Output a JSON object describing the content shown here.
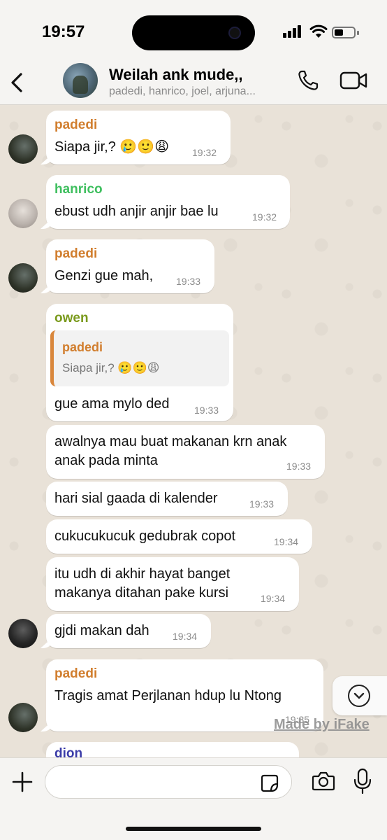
{
  "status_bar": {
    "time": "19:57",
    "battery_level": 0.45
  },
  "header": {
    "title": "Weilah ank mude,,",
    "members": "padedi, hanrico, joel, arjuna..."
  },
  "colors": {
    "padedi": "#d17e2e",
    "hanrico": "#3fbf5f",
    "owen": "#7a9a1c",
    "dion": "#3b3ca8"
  },
  "messages": [
    {
      "sender": "padedi",
      "text": "Siapa jir,? 🥲🙂😩",
      "time": "19:32"
    },
    {
      "sender": "hanrico",
      "text": "ebust udh anjir anjir bae lu",
      "time": "19:32"
    },
    {
      "sender": "padedi",
      "text": "Genzi gue mah,",
      "time": "19:33"
    },
    {
      "sender": "owen",
      "quote_sender": "padedi",
      "quote_text": "Siapa jir,? 🥲🙂😩",
      "text": "gue ama mylo ded",
      "time": "19:33"
    },
    {
      "text_line1": "awalnya mau buat makanan krn anak",
      "text_line2": "anak pada minta",
      "time": "19:33"
    },
    {
      "text": "hari sial gaada di kalender",
      "time": "19:33"
    },
    {
      "text": "cukucukucuk gedubrak copot",
      "time": "19:34"
    },
    {
      "text_line1": "itu udh di akhir hayat banget",
      "text_line2": "makanya ditahan pake kursi",
      "time": "19:34"
    },
    {
      "text": "gjdi makan dah",
      "time": "19:34"
    },
    {
      "sender": "padedi",
      "text": "Tragis amat Perjlanan hdup lu Ntong",
      "time": "19:35"
    },
    {
      "sender": "dion"
    }
  ],
  "watermark": "Made by iFake",
  "input": {
    "placeholder": ""
  }
}
